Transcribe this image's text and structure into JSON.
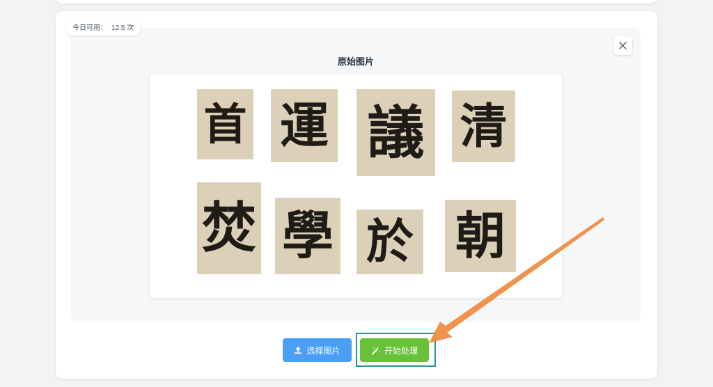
{
  "usage": {
    "label": "今日可用：",
    "value": "12.5 次"
  },
  "preview": {
    "title": "原始图片",
    "close_icon": "close-icon",
    "characters": [
      "首",
      "運",
      "議",
      "清",
      "焚",
      "學",
      "於",
      "朝"
    ]
  },
  "actions": {
    "upload_label": "选择图片",
    "upload_icon": "upload-icon",
    "start_label": "开始处理",
    "start_icon": "magic-wand-icon"
  },
  "colors": {
    "upload_button": "#4a9ff5",
    "start_button": "#67c23a",
    "highlight_box": "#1f9a8c",
    "arrow": "#f08a3e",
    "paper": "#ddd0b9",
    "ink": "#1f1b16"
  }
}
